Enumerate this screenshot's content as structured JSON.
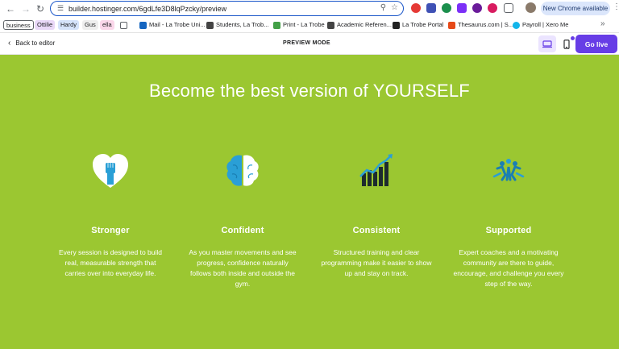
{
  "browser": {
    "url": "builder.hostinger.com/6gdLfe3D8lqPzcky/preview",
    "update_label": "New Chrome available"
  },
  "bookmarks": {
    "chips": [
      {
        "label": "business",
        "bg": "#ffffff",
        "border": "#5f6368"
      },
      {
        "label": "Ottilie",
        "bg": "#e9d8f7",
        "border": ""
      },
      {
        "label": "Hardy",
        "bg": "#d5e3fb",
        "border": ""
      },
      {
        "label": "Gus",
        "bg": "#eeeeee",
        "border": ""
      },
      {
        "label": "ella",
        "bg": "#fbd7ea",
        "border": ""
      }
    ],
    "items": [
      {
        "label": "Mail - La Trobe Uni...",
        "icon": "mail-icon"
      },
      {
        "label": "Students, La Trob...",
        "icon": "latrobe-icon"
      },
      {
        "label": "Print - La Trobe",
        "icon": "print-icon"
      },
      {
        "label": "Academic Referen...",
        "icon": "latrobe-icon"
      },
      {
        "label": "La Trobe Portal",
        "icon": "latrobe-icon"
      },
      {
        "label": "Thesaurus.com | S...",
        "icon": "thesaurus-icon"
      },
      {
        "label": "Payroll | Xero Me",
        "icon": "xero-icon"
      }
    ]
  },
  "editor": {
    "back_label": "Back to editor",
    "mode_label": "PREVIEW MODE",
    "golive_label": "Go live",
    "accent": "#673de6"
  },
  "page": {
    "background": "#9bc731",
    "title": "Become the best version of YOURSELF",
    "features": [
      {
        "icon": "heart-fist-icon",
        "title": "Stronger",
        "description": "Every session is designed to build real, measurable strength that carries over into everyday life."
      },
      {
        "icon": "brain-icon",
        "title": "Confident",
        "description": "As you master movements and see progress, confidence naturally follows both inside and outside the gym."
      },
      {
        "icon": "growth-chart-icon",
        "title": "Consistent",
        "description": "Structured training and clear programming make it easier to show up and stay on track."
      },
      {
        "icon": "team-people-icon",
        "title": "Supported",
        "description": "Expert coaches and a motivating community are there to guide, encourage, and challenge you every step of the way."
      }
    ]
  }
}
